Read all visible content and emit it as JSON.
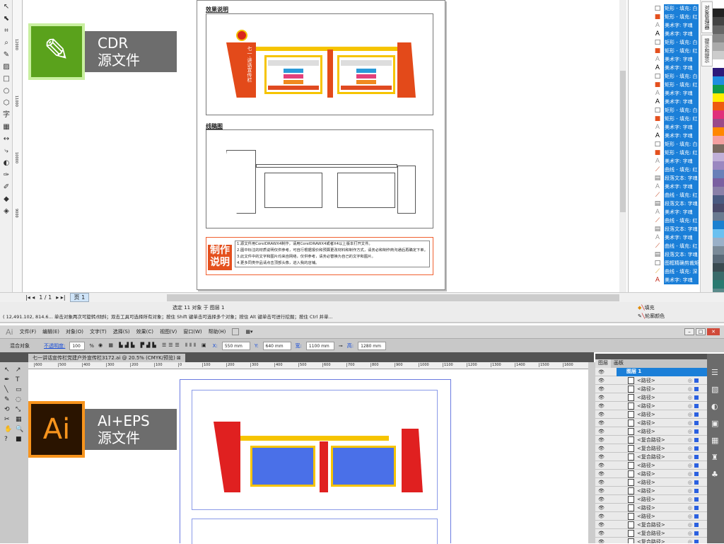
{
  "cdr": {
    "toolbox_icons": [
      "pick-tool",
      "shape-tool",
      "crop-tool",
      "zoom-tool",
      "freehand-tool",
      "smart-fill-tool",
      "rectangle-tool",
      "ellipse-tool",
      "polygon-tool",
      "text-tool",
      "table-tool",
      "dimension-tool",
      "connector-tool",
      "interactive-tool",
      "eyedropper-tool",
      "outline-tool",
      "fill-tool",
      "interactive-fill-tool"
    ],
    "ruler_ticks": [
      "12000",
      "11000",
      "10000",
      "9000"
    ],
    "badge": {
      "line1": "CDR",
      "line2": "源文件",
      "color": "#5aa21c"
    },
    "page": {
      "section1_title": "效果说明",
      "section2_title": "线稿图",
      "sign_title": "七一·讲话宣传栏",
      "note_title": "制作说明",
      "notes": [
        "1.源文件用CorelDRAWX4制作，请用CorelDRAWX4或者X4以上版本打开文件。",
        "2.图中标注的材质说明仅供参考，可自行根据报价和预算更改材料和制作方式，请务必和制作商沟通后再确定下单。",
        "3.此文件中的文字和图片均来自网络，仅供参考，请务必替换为自己的文字和图片。",
        "4.更多同类作品请点击顶部头像，进入我的店铺。"
      ]
    },
    "object_manager": {
      "tab_title": "对象管理器",
      "tab2_title": "提示和提示",
      "items": [
        {
          "icon": "rect-white",
          "label": "矩形 - 填充: 白"
        },
        {
          "icon": "rect-red",
          "label": "矩形 - 填充: 红"
        },
        {
          "icon": "artistic-text-outline",
          "label": "美术字: 字魂"
        },
        {
          "icon": "artistic-text",
          "label": "美术字: 字魂"
        },
        {
          "icon": "rect-white",
          "label": "矩形 - 填充: 白"
        },
        {
          "icon": "rect-red",
          "label": "矩形 - 填充: 红"
        },
        {
          "icon": "artistic-text-outline",
          "label": "美术字: 字魂"
        },
        {
          "icon": "artistic-text",
          "label": "美术字: 字魂"
        },
        {
          "icon": "rect-white",
          "label": "矩形 - 填充: 白"
        },
        {
          "icon": "rect-red",
          "label": "矩形 - 填充: 红"
        },
        {
          "icon": "artistic-text-outline",
          "label": "美术字: 字魂"
        },
        {
          "icon": "artistic-text",
          "label": "美术字: 字魂"
        },
        {
          "icon": "rect-white",
          "label": "矩形 - 填充: 白"
        },
        {
          "icon": "rect-red",
          "label": "矩形 - 填充: 红"
        },
        {
          "icon": "artistic-text-outline",
          "label": "美术字: 字魂"
        },
        {
          "icon": "artistic-text",
          "label": "美术字: 字魂"
        },
        {
          "icon": "rect-white",
          "label": "矩形 - 填充: 白"
        },
        {
          "icon": "rect-red",
          "label": "矩形 - 填充: 红"
        },
        {
          "icon": "artistic-text-outline",
          "label": "美术字: 字魂"
        },
        {
          "icon": "curve-red",
          "label": "曲线 - 填充: 红"
        },
        {
          "icon": "paragraph-text",
          "label": "段落文本: 字魂"
        },
        {
          "icon": "artistic-text-outline",
          "label": "美术字: 字魂"
        },
        {
          "icon": "curve-red",
          "label": "曲线 - 填充: 红"
        },
        {
          "icon": "paragraph-text",
          "label": "段落文本: 字魂"
        },
        {
          "icon": "artistic-text-outline",
          "label": "美术字: 字魂"
        },
        {
          "icon": "curve-red",
          "label": "曲线 - 填充: 红"
        },
        {
          "icon": "paragraph-text",
          "label": "段落文本: 字魂"
        },
        {
          "icon": "artistic-text-outline",
          "label": "美术字: 字魂"
        },
        {
          "icon": "curve-red",
          "label": "曲线 - 填充: 红"
        },
        {
          "icon": "paragraph-text",
          "label": "段落文本: 字魂"
        },
        {
          "icon": "powerclip",
          "label": "图框精确剪裁矩"
        },
        {
          "icon": "curve-yellow",
          "label": "曲线 - 填充: 深"
        },
        {
          "icon": "artistic-text-red",
          "label": "美术字: 字魂"
        }
      ]
    },
    "palette": [
      "#ffffff",
      "#222222",
      "#444444",
      "#666666",
      "#888888",
      "#aaaaaa",
      "#cccccc",
      "#ffffff",
      "#2e1a7a",
      "#1f8ee0",
      "#0f9a4a",
      "#ffee00",
      "#ee5a10",
      "#e0307a",
      "#9a4a8a",
      "#ff8800",
      "#f4a0a0",
      "#7a6a60",
      "#c0b0d8",
      "#9a88c0",
      "#6a80b8",
      "#7a60a0",
      "#8a80a8",
      "#4a5a80",
      "#4a4a6a",
      "#6a7a90",
      "#1a80d0",
      "#6ac0f0",
      "#9ab0c8",
      "#7a8a98",
      "#5a6a78",
      "#3a4a50",
      "#3a6a6a",
      "#2a7a70",
      "#5a8a8a"
    ],
    "pagebar": {
      "page_count": "1 / 1",
      "page_tab": "页 1"
    },
    "status": {
      "selection": "选定 11 对象 于 图层 1",
      "hint": "( 12,491.102, 814.6... 单击对象两次可旋转/倾斜；双击工具可选择所有对象；按住 Shift 键单击可选择多个对象；按住 Alt 键单击可进行挖掘；按住 Ctrl 并单...",
      "fill_label": "填充",
      "outline_label": "轮廓颜色"
    }
  },
  "ai": {
    "logo": "Ai",
    "menu": [
      "文件(F)",
      "编辑(E)",
      "对象(O)",
      "文字(T)",
      "选择(S)",
      "效果(C)",
      "视图(V)",
      "窗口(W)",
      "帮助(H)"
    ],
    "control": {
      "object_type": "混合对象",
      "opacity_label": "不透明度:",
      "opacity_value": "100",
      "opacity_unit": "%",
      "x_label": "X:",
      "x_value": "550 mm",
      "y_label": "Y:",
      "y_value": "640 mm",
      "w_label": "宽:",
      "w_value": "1100 mm",
      "h_label": "高:",
      "h_value": "1280 mm"
    },
    "doc_tab": "七一讲话宣传栏党建户外宣传栏3172.ai @ 20.5% (CMYK/预览)",
    "ruler_ticks": [
      "600",
      "500",
      "400",
      "300",
      "200",
      "100",
      "0",
      "100",
      "200",
      "300",
      "400",
      "500",
      "600",
      "700",
      "800",
      "900",
      "1000",
      "1100",
      "1200",
      "1300",
      "1400",
      "1500",
      "1600"
    ],
    "badge": {
      "line1": "AI+EPS",
      "line2": "源文件",
      "color": "#f7941d"
    },
    "layers": {
      "tabs": [
        "图层",
        "画板"
      ],
      "layer_name": "图层 1",
      "items": [
        "<路径>",
        "<路径>",
        "<路径>",
        "<路径>",
        "<路径>",
        "<路径>",
        "<路径>",
        "<复合路径>",
        "<复合路径>",
        "<复合路径>",
        "<路径>",
        "<路径>",
        "<路径>",
        "<路径>",
        "<路径>",
        "<路径>",
        "<路径>",
        "<复合路径>",
        "<复合路径>",
        "<复合路径>"
      ]
    }
  }
}
